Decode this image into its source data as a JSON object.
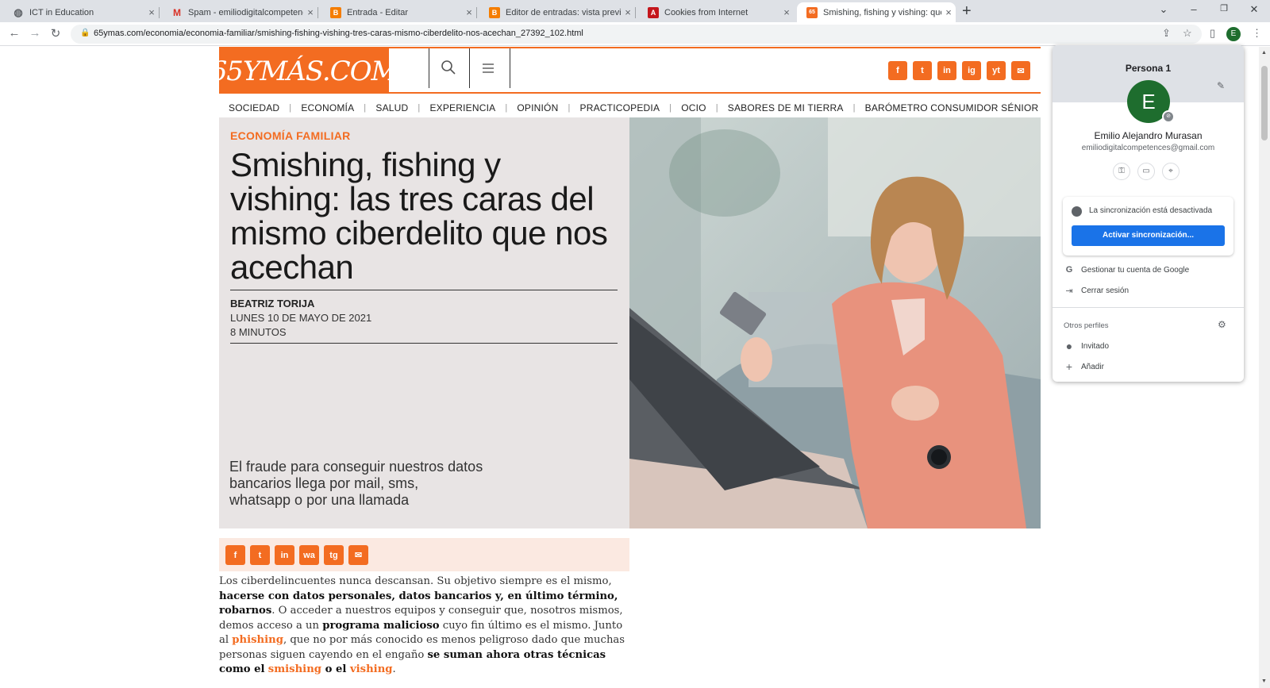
{
  "browser": {
    "tabs": [
      {
        "title": "ICT in Education",
        "favicon": "globe-icon"
      },
      {
        "title": "Spam - emiliodigitalcompetence",
        "favicon": "gmail-icon"
      },
      {
        "title": "Entrada - Editar",
        "favicon": "blogger-icon"
      },
      {
        "title": "Editor de entradas: vista previa",
        "favicon": "blogger-icon"
      },
      {
        "title": "Cookies from Internet",
        "favicon": "acrobat-icon"
      },
      {
        "title": "Smishing, fishing y vishing: qué e",
        "favicon": "65ymas-icon"
      }
    ],
    "close_glyph": "×",
    "new_tab": "+",
    "url": "65ymas.com/economia/economia-familiar/smishing-fishing-vishing-tres-caras-mismo-ciberdelito-nos-acechan_27392_102.html",
    "avatar_letter": "E"
  },
  "site": {
    "logo": "65YMÁS.COM",
    "accent": "#f36c21",
    "social": [
      "f",
      "t",
      "in",
      "ig",
      "yt",
      "✉"
    ],
    "nav": [
      "SOCIEDAD",
      "ECONOMÍA",
      "SALUD",
      "EXPERIENCIA",
      "OPINIÓN",
      "PRACTICOPEDIA",
      "OCIO",
      "SABORES DE MI TIERRA",
      "BARÓMETRO CONSUMIDOR SÉNIOR"
    ],
    "nav_sep": "|"
  },
  "article": {
    "category": "ECONOMÍA FAMILIAR",
    "headline": "Smishing, fishing y vishing: las tres caras del mismo ciberdelito que nos acechan",
    "author": "BEATRIZ TORIJA",
    "date": "LUNES 10 DE MAYO DE 2021",
    "read_time": "8 MINUTOS",
    "subtitle": "El fraude para conseguir nuestros datos bancarios llega por mail, sms, whatsapp o por una llamada",
    "share": [
      "f",
      "t",
      "in",
      "wa",
      "tg",
      "✉"
    ],
    "body": {
      "p1": "Los ciberdelincuentes nunca descansan. Su objetivo siempre es el mismo, ",
      "b1": "hacerse con datos personales, datos bancarios y, en último término, robarnos",
      "p2": ". O acceder a nuestros equipos y conseguir que, nosotros mismos, demos acceso a un ",
      "b2": "programa malicioso",
      "p3": " cuyo fin último es el mismo. Junto al ",
      "l1": "phishing",
      "p4": ", que no por más conocido es menos peligroso dado que muchas personas siguen cayendo en el engaño ",
      "b3": "se suman ahora otras técnicas como el",
      "l2": "smishing",
      "p5": " o el ",
      "l3": "vishing",
      "p6": "."
    }
  },
  "profile_menu": {
    "title": "Persona 1",
    "avatar_letter": "E",
    "name": "Emilio Alejandro Murasan",
    "email": "emiliodigitalcompetences@gmail.com",
    "sync_status": "La sincronización está desactivada",
    "sync_button": "Activar sincronización...",
    "manage_account": "Gestionar tu cuenta de Google",
    "sign_out": "Cerrar sesión",
    "other_profiles": "Otros perfiles",
    "guest": "Invitado",
    "add": "Añadir"
  }
}
